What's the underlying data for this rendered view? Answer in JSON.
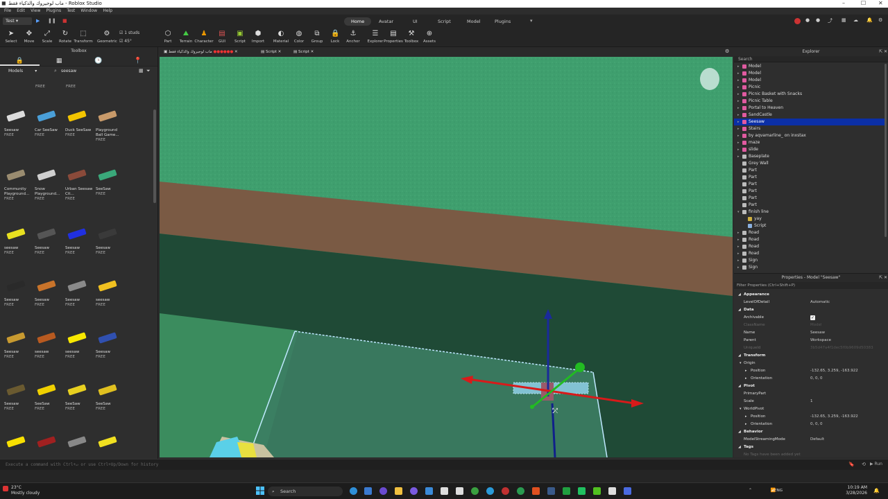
{
  "window": {
    "title": "ماب لوجيروك والذكياء فقط - Roblox Studio"
  },
  "menu": [
    "File",
    "Edit",
    "View",
    "Plugins",
    "Test",
    "Window",
    "Help"
  ],
  "ribbon": {
    "mode": "Test",
    "tabs": [
      "Home",
      "Avatar",
      "UI",
      "Script",
      "Model",
      "Plugins"
    ],
    "active_tab": "Home",
    "studs": "1 studs",
    "degrees": "45°",
    "tools": [
      "Select",
      "Move",
      "Scale",
      "Rotate",
      "Transform",
      "Geometric",
      "Part",
      "Terrain",
      "Character",
      "GUI",
      "Script",
      "Import",
      "Material",
      "Color",
      "Group",
      "Lock",
      "Anchor",
      "Explorer",
      "Properties",
      "Toolbox",
      "Assets"
    ]
  },
  "toolbox": {
    "title": "Toolbox",
    "category": "Models",
    "query": "seesaw",
    "top_free": [
      "FREE",
      "FREE"
    ],
    "items": [
      {
        "name": "Seesaw",
        "price": "FREE",
        "color": "#dcdcdc"
      },
      {
        "name": "Car SeeSaw",
        "price": "FREE",
        "color": "#4a9fd8"
      },
      {
        "name": "Duck SeeSaw",
        "price": "FREE",
        "color": "#f2c400"
      },
      {
        "name": "Playground Ball Game...",
        "price": "FREE",
        "color": "#c89a6a"
      },
      {
        "name": "Community Playground...",
        "price": "FREE",
        "color": "#9a8c70"
      },
      {
        "name": "Snow Playground...",
        "price": "FREE",
        "color": "#cfcfcf"
      },
      {
        "name": "Urban Seesaw Cit...",
        "price": "FREE",
        "color": "#8a4a3a"
      },
      {
        "name": "SeeSaw",
        "price": "FREE",
        "color": "#3aa87a"
      },
      {
        "name": "seesaw",
        "price": "FREE",
        "color": "#e8e020"
      },
      {
        "name": "Seesaw",
        "price": "FREE",
        "color": "#555555"
      },
      {
        "name": "Seesaw",
        "price": "FREE",
        "color": "#2030e0"
      },
      {
        "name": "Seesaw",
        "price": "FREE",
        "color": "#3a3a3a"
      },
      {
        "name": "Seesaw",
        "price": "FREE",
        "color": "#2a2a2a"
      },
      {
        "name": "Seesaw",
        "price": "FREE",
        "color": "#c8732a"
      },
      {
        "name": "Seesaw",
        "price": "FREE",
        "color": "#8a8a8a"
      },
      {
        "name": "seesaw",
        "price": "FREE",
        "color": "#f0c020"
      },
      {
        "name": "Seesaw",
        "price": "FREE",
        "color": "#c89a30"
      },
      {
        "name": "seesaw",
        "price": "FREE",
        "color": "#b85a20"
      },
      {
        "name": "seesaw",
        "price": "FREE",
        "color": "#f8e800"
      },
      {
        "name": "Seesaw",
        "price": "FREE",
        "color": "#3050b0"
      },
      {
        "name": "Seesaw",
        "price": "FREE",
        "color": "#6a5a30"
      },
      {
        "name": "SeeSaw",
        "price": "FREE",
        "color": "#f0d000"
      },
      {
        "name": "SeeSaw",
        "price": "FREE",
        "color": "#e8d020"
      },
      {
        "name": "SeeSaw",
        "price": "FREE",
        "color": "#e0c020"
      },
      {
        "name": "",
        "price": "",
        "color": "#f8e000"
      },
      {
        "name": "",
        "price": "",
        "color": "#a02020"
      },
      {
        "name": "",
        "price": "",
        "color": "#888888"
      },
      {
        "name": "",
        "price": "",
        "color": "#f0e020"
      }
    ]
  },
  "script_tabs": [
    "ماب لوجيروك والذكياء فقط",
    "Script",
    "Script"
  ],
  "explorer": {
    "title": "Explorer",
    "search_placeholder": "Search",
    "rows": [
      {
        "label": "Model",
        "icon": "model-icon",
        "level": 1,
        "arrow": "▸"
      },
      {
        "label": "Model",
        "icon": "model-icon",
        "level": 1,
        "arrow": "▸"
      },
      {
        "label": "Model",
        "icon": "model-icon",
        "level": 1,
        "arrow": "▸"
      },
      {
        "label": "Picnic",
        "icon": "model-icon",
        "level": 1,
        "arrow": "▸"
      },
      {
        "label": "Picnic Basket with Snacks",
        "icon": "model-icon",
        "level": 1,
        "arrow": "▸"
      },
      {
        "label": "Picnic Table",
        "icon": "model-icon",
        "level": 1,
        "arrow": "▸"
      },
      {
        "label": "Portal to Heaven",
        "icon": "model-icon",
        "level": 1,
        "arrow": "▸"
      },
      {
        "label": "SandCastle",
        "icon": "model-icon",
        "level": 1,
        "arrow": "▸"
      },
      {
        "label": "Seesaw",
        "icon": "model-icon",
        "level": 1,
        "arrow": "▸",
        "selected": true
      },
      {
        "label": "Stairs",
        "icon": "model-icon",
        "level": 1,
        "arrow": "▸"
      },
      {
        "label": "by aqvamarline_ on inxstax",
        "icon": "model-icon",
        "level": 1,
        "arrow": "▸"
      },
      {
        "label": "maze",
        "icon": "model-icon",
        "level": 1,
        "arrow": "▸"
      },
      {
        "label": "slide",
        "icon": "model-icon",
        "level": 1,
        "arrow": "▸"
      },
      {
        "label": "Baseplate",
        "icon": "part-icon",
        "level": 1,
        "arrow": "▸"
      },
      {
        "label": "Grey Wall",
        "icon": "part-icon",
        "level": 1,
        "arrow": ""
      },
      {
        "label": "Part",
        "icon": "part-icon",
        "level": 1,
        "arrow": ""
      },
      {
        "label": "Part",
        "icon": "part-icon",
        "level": 1,
        "arrow": ""
      },
      {
        "label": "Part",
        "icon": "part-icon",
        "level": 1,
        "arrow": ""
      },
      {
        "label": "Part",
        "icon": "part-icon",
        "level": 1,
        "arrow": ""
      },
      {
        "label": "Part",
        "icon": "part-icon",
        "level": 1,
        "arrow": ""
      },
      {
        "label": "Part",
        "icon": "part-icon",
        "level": 1,
        "arrow": ""
      },
      {
        "label": "finish line",
        "icon": "part-icon",
        "level": 1,
        "arrow": "▾"
      },
      {
        "label": "yay",
        "icon": "decal-icon",
        "level": 2,
        "arrow": ""
      },
      {
        "label": "Script",
        "icon": "script-icon",
        "level": 2,
        "arrow": ""
      },
      {
        "label": "Road",
        "icon": "part-icon",
        "level": 1,
        "arrow": "▸"
      },
      {
        "label": "Road",
        "icon": "part-icon",
        "level": 1,
        "arrow": "▸"
      },
      {
        "label": "Road",
        "icon": "part-icon",
        "level": 1,
        "arrow": "▸"
      },
      {
        "label": "Road",
        "icon": "part-icon",
        "level": 1,
        "arrow": "▸"
      },
      {
        "label": "Sign",
        "icon": "part-icon",
        "level": 1,
        "arrow": "▸"
      },
      {
        "label": "Sign",
        "icon": "part-icon",
        "level": 1,
        "arrow": "▸"
      }
    ]
  },
  "properties": {
    "title": "Properties - Model \"Seesaw\"",
    "filter_placeholder": "Filter Properties (Ctrl+Shift+P)",
    "rows": [
      {
        "type": "section",
        "key": "Appearance"
      },
      {
        "type": "prop",
        "key": "LevelOfDetail",
        "value": "Automatic"
      },
      {
        "type": "section",
        "key": "Data"
      },
      {
        "type": "prop",
        "key": "Archivable",
        "value": "",
        "checkbox": true
      },
      {
        "type": "prop",
        "key": "ClassName",
        "value": "Model",
        "dim": true
      },
      {
        "type": "prop",
        "key": "Name",
        "value": "Seesaw"
      },
      {
        "type": "prop",
        "key": "Parent",
        "value": "Workspace"
      },
      {
        "type": "prop",
        "key": "UniqueId",
        "value": "3b5d47a4f1dec5f0b9609d50383",
        "dim": true
      },
      {
        "type": "section",
        "key": "Transform"
      },
      {
        "type": "sub",
        "key": "Origin"
      },
      {
        "type": "prop2",
        "key": "Position",
        "value": "-132.65, 3.259, -163.922"
      },
      {
        "type": "prop2",
        "key": "Orientation",
        "value": "0, 0, 0"
      },
      {
        "type": "section",
        "key": "Pivot"
      },
      {
        "type": "prop",
        "key": "PrimaryPart",
        "value": ""
      },
      {
        "type": "prop",
        "key": "Scale",
        "value": "1"
      },
      {
        "type": "sub",
        "key": "WorldPivot"
      },
      {
        "type": "prop2",
        "key": "Position",
        "value": "-132.65, 3.259, -163.922"
      },
      {
        "type": "prop2",
        "key": "Orientation",
        "value": "0, 0, 0"
      },
      {
        "type": "section",
        "key": "Behavior"
      },
      {
        "type": "prop",
        "key": "ModelStreamingMode",
        "value": "Default"
      },
      {
        "type": "section",
        "key": "Tags"
      },
      {
        "type": "prop",
        "key": "No Tags have been added yet",
        "value": "",
        "dim": true
      }
    ]
  },
  "command_bar": {
    "placeholder": "Execute a command with Ctrl+↵ or use Ctrl+Up/Down for history",
    "run_label": "Run"
  },
  "taskbar": {
    "temp": "23°C",
    "weather": "Mostly cloudy",
    "search": "Search",
    "lang": "ENG",
    "time": "10:19 AM",
    "date": "3/28/2026"
  },
  "colors": {
    "selection": "#0b2fa6",
    "viewport_green": "#3c9c6d",
    "wall_brown": "#7a5a44",
    "gizmo_x": "#d81a1a",
    "gizmo_y": "#22bb22",
    "gizmo_z": "#1a2a9a"
  }
}
